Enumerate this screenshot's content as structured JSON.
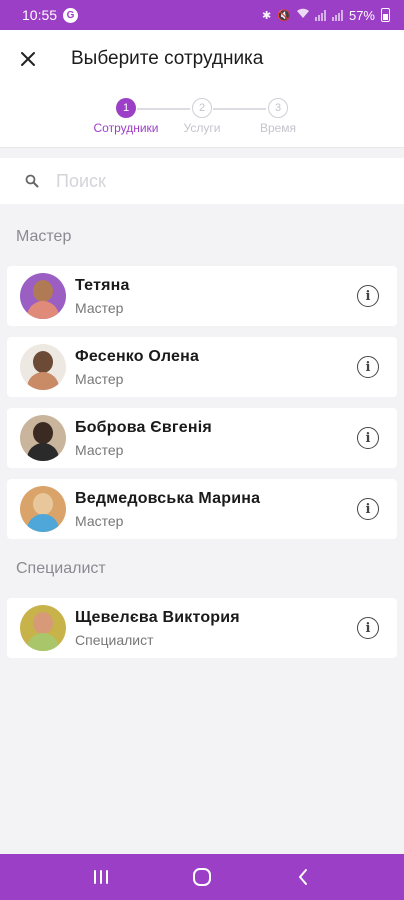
{
  "status_bar": {
    "time": "10:55",
    "notification_badge": "G",
    "battery": "57%"
  },
  "header": {
    "title": "Выберите сотрудника"
  },
  "stepper": {
    "steps": [
      {
        "number": "1",
        "label": "Сотрудники",
        "state": "active"
      },
      {
        "number": "2",
        "label": "Услуги",
        "state": "inactive"
      },
      {
        "number": "3",
        "label": "Время",
        "state": "inactive"
      }
    ]
  },
  "search": {
    "placeholder": "Поиск",
    "value": ""
  },
  "sections": [
    {
      "title": "Мастер",
      "staff": [
        {
          "name": "Тетяна",
          "role": "Мастер"
        },
        {
          "name": "Фесенко Олена",
          "role": "Мастер"
        },
        {
          "name": "Боброва Євгенія",
          "role": "Мастер"
        },
        {
          "name": "Ведмедовська Марина",
          "role": "Мастер"
        }
      ]
    },
    {
      "title": "Специалист",
      "staff": [
        {
          "name": "Щевелєва Виктория",
          "role": "Специалист"
        }
      ]
    }
  ],
  "colors": {
    "accent": "#9c3fc7",
    "background": "#f3f3f5"
  },
  "icons": {
    "close": "close-icon",
    "search": "search-icon",
    "info": "info-icon",
    "nav_recents": "recents-icon",
    "nav_home": "home-icon",
    "nav_back": "back-icon"
  }
}
